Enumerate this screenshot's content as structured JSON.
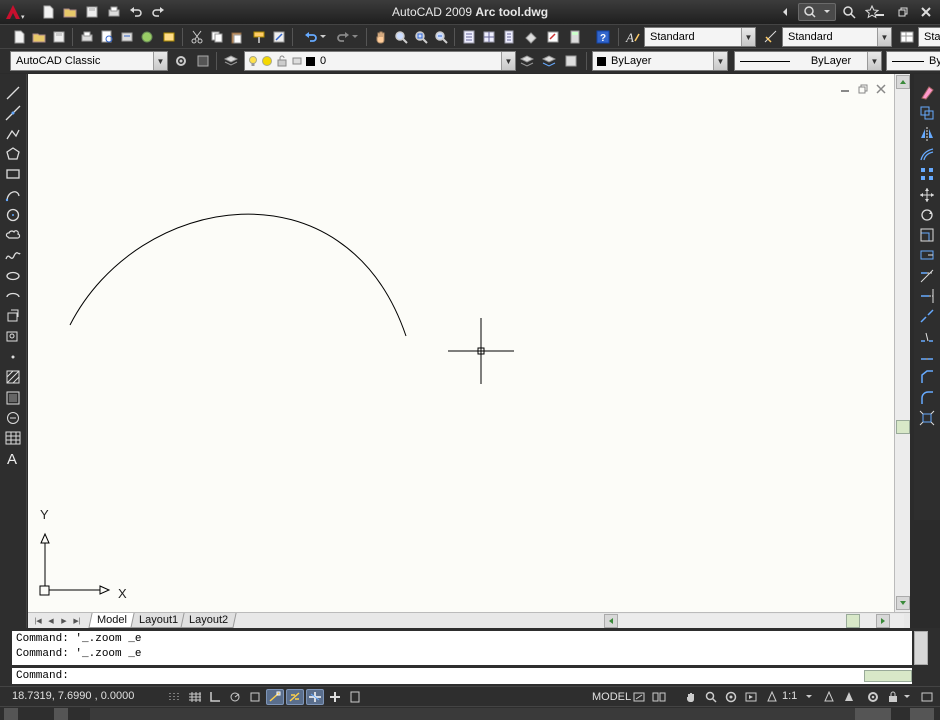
{
  "window": {
    "app_name": "AutoCAD 2009",
    "document_name": "Arc tool.dwg"
  },
  "toolbars": {
    "text_style": "Standard",
    "dim_style": "Standard",
    "table_style": "Standard",
    "workspace": "AutoCAD Classic",
    "layer_name": "0",
    "color": "ByLayer",
    "linetype": "ByLayer",
    "lineweight_partial": "ByL"
  },
  "layout_tabs": [
    {
      "label": "Model",
      "active": true
    },
    {
      "label": "Layout1",
      "active": false
    },
    {
      "label": "Layout2",
      "active": false
    }
  ],
  "ucs": {
    "x_label": "X",
    "y_label": "Y"
  },
  "command_window": {
    "history": [
      "Command: '_.zoom _e",
      "Command: '_.zoom _e"
    ],
    "prompt": "Command:"
  },
  "statusbar": {
    "coordinates": "18.7319, 7.6990 , 0.0000",
    "space": "MODEL",
    "annotation_scale": "1:1"
  },
  "icons": {
    "left_toolbar": [
      "line-icon",
      "construction-line-icon",
      "polyline-icon",
      "polygon-icon",
      "rectangle-icon",
      "arc-icon",
      "circle-icon",
      "revision-cloud-icon",
      "spline-icon",
      "ellipse-icon",
      "ellipse-arc-icon",
      "insert-block-icon",
      "make-block-icon",
      "point-icon",
      "hatch-icon",
      "gradient-icon",
      "region-icon",
      "table-icon",
      "multiline-text-icon"
    ],
    "right_toolbar": [
      "erase-icon",
      "copy-icon",
      "mirror-icon",
      "offset-icon",
      "array-icon",
      "move-icon",
      "rotate-icon",
      "scale-icon",
      "stretch-icon",
      "trim-icon",
      "extend-icon",
      "break-at-point-icon",
      "break-icon",
      "join-icon",
      "chamfer-icon",
      "fillet-icon",
      "explode-icon"
    ]
  }
}
